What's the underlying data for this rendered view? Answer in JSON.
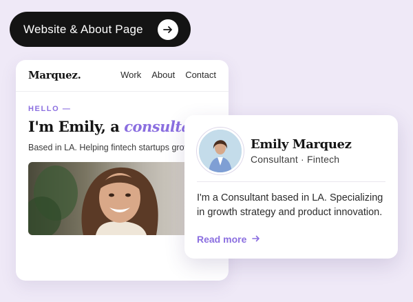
{
  "pill": {
    "label": "Website & About Page",
    "arrow_icon": "arrow-right-icon"
  },
  "site": {
    "logo": "Marquez.",
    "nav": [
      "Work",
      "About",
      "Contact"
    ],
    "eyebrow": "HELLO —",
    "headline_plain": "I'm Emily, a ",
    "headline_accent": "consultant",
    "subline": "Based in LA. Helping fintech startups grow.",
    "photo_alt": "Portrait of Emily smiling"
  },
  "profile": {
    "name": "Emily Marquez",
    "role": "Consultant · Fintech",
    "bio": "I'm a Consultant based in LA. Specializing in growth strategy and product innovation.",
    "cta": "Read more",
    "cta_icon": "arrow-right-icon"
  },
  "colors": {
    "accent": "#8b6fe0",
    "background": "#efe9f7",
    "pill": "#141414"
  }
}
